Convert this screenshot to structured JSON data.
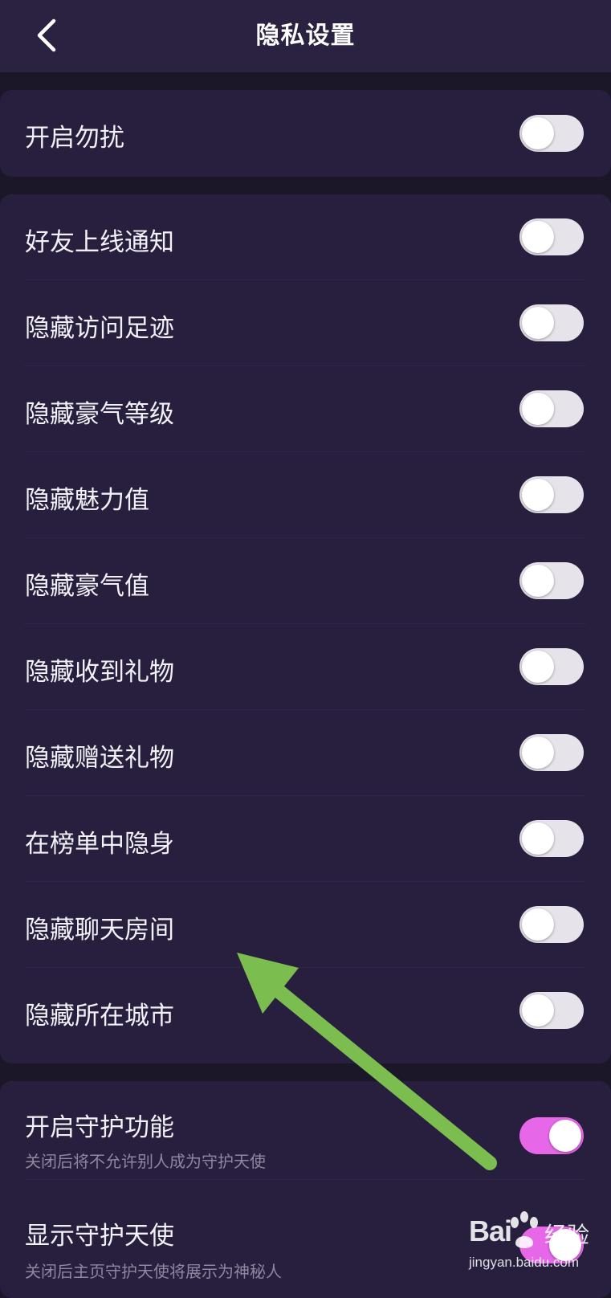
{
  "header": {
    "title": "隐私设置"
  },
  "sections": [
    {
      "items": [
        {
          "label": "开启勿扰",
          "state": "off"
        }
      ]
    },
    {
      "items": [
        {
          "label": "好友上线通知",
          "state": "off"
        },
        {
          "label": "隐藏访问足迹",
          "state": "off"
        },
        {
          "label": "隐藏豪气等级",
          "state": "off"
        },
        {
          "label": "隐藏魅力值",
          "state": "off"
        },
        {
          "label": "隐藏豪气值",
          "state": "off"
        },
        {
          "label": "隐藏收到礼物",
          "state": "off"
        },
        {
          "label": "隐藏赠送礼物",
          "state": "off"
        },
        {
          "label": "在榜单中隐身",
          "state": "off"
        },
        {
          "label": "隐藏聊天房间",
          "state": "off"
        },
        {
          "label": "隐藏所在城市",
          "state": "off"
        }
      ]
    },
    {
      "items": [
        {
          "label": "开启守护功能",
          "sublabel": "关闭后将不允许别人成为守护天使",
          "state": "on"
        },
        {
          "label": "显示守护天使",
          "sublabel": "关闭后主页守护天使将展示为神秘人",
          "state": "on"
        }
      ]
    }
  ],
  "icons": {
    "back": "chevron-left-icon"
  },
  "colors": {
    "background": "#1b1628",
    "card": "#271f3d",
    "toggle_off": "#e6e4ea",
    "toggle_on": "#e667e8",
    "annotation_arrow": "#7cbd50"
  },
  "watermark": {
    "logo_left": "Bai",
    "logo_right": "经验",
    "url": "jingyan.baidu.com"
  }
}
